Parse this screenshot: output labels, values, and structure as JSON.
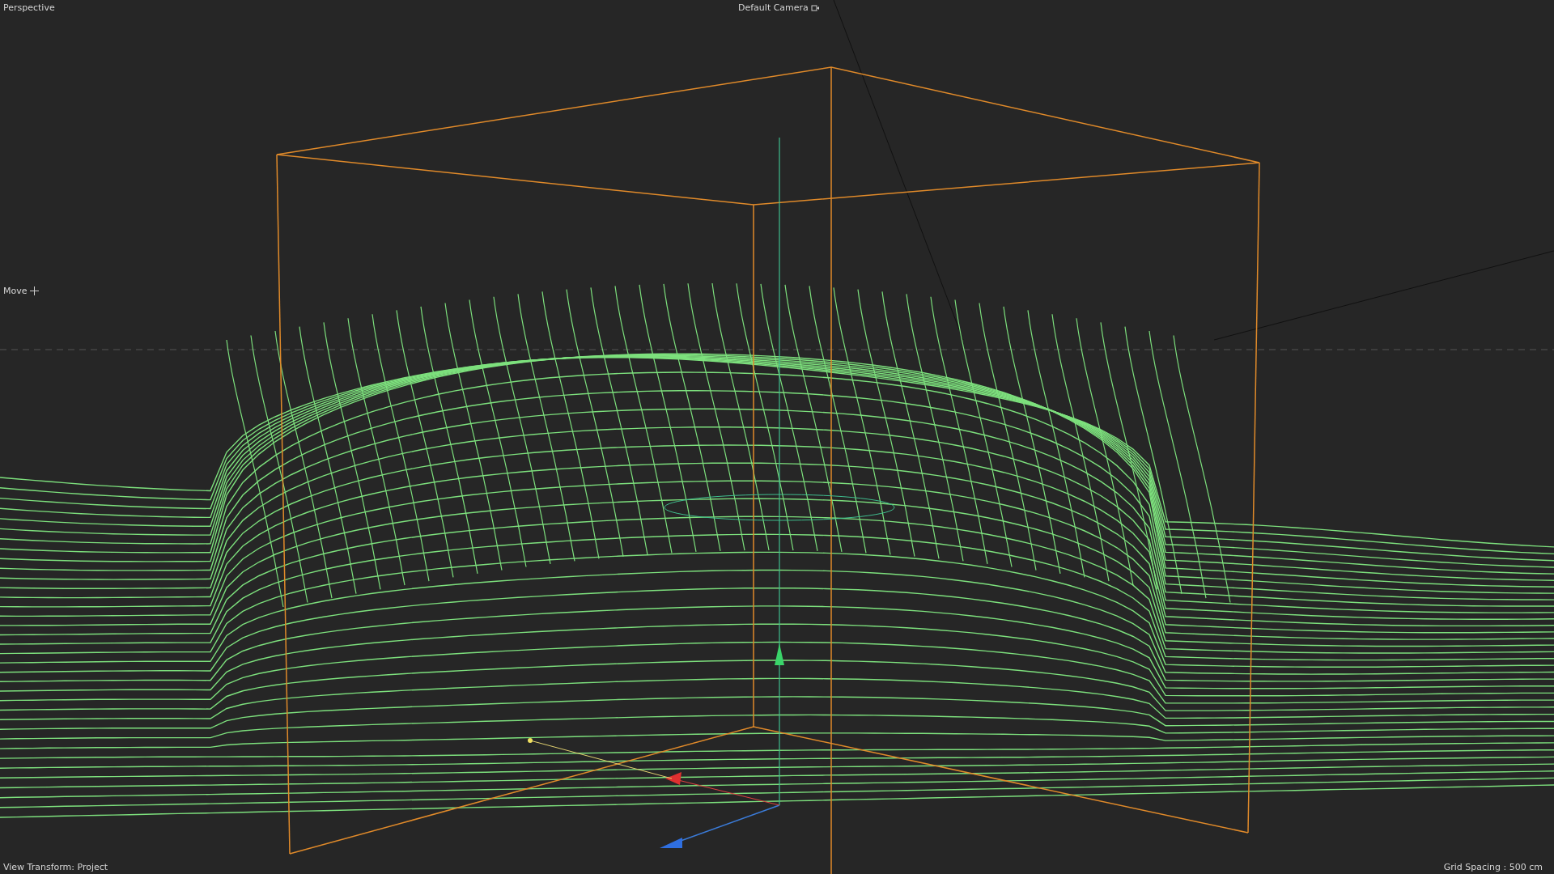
{
  "viewport": {
    "view_name": "Perspective",
    "camera": "Default Camera",
    "tool": "Move",
    "view_transform": "View Transform: Project",
    "grid_spacing": "Grid Spacing : 500 cm"
  }
}
